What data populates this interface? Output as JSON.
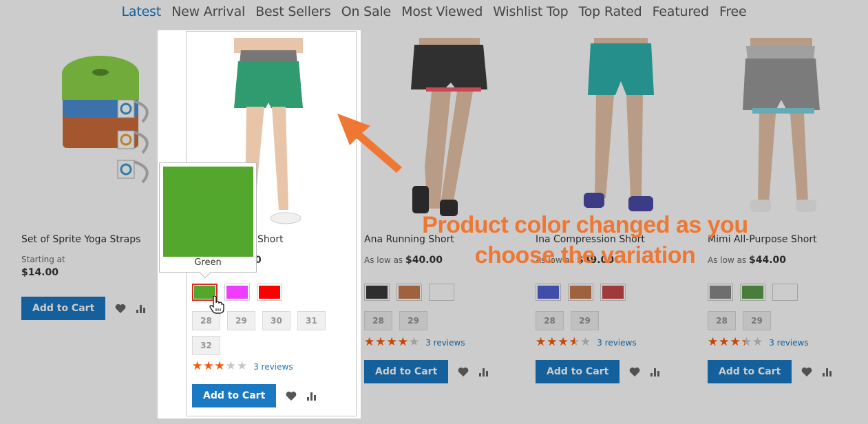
{
  "tabs": [
    {
      "label": "Latest",
      "active": true
    },
    {
      "label": "New Arrival"
    },
    {
      "label": "Best Sellers"
    },
    {
      "label": "On Sale"
    },
    {
      "label": "Most Viewed"
    },
    {
      "label": "Wishlist Top"
    },
    {
      "label": "Top Rated"
    },
    {
      "label": "Featured"
    },
    {
      "label": "Free"
    }
  ],
  "products": [
    {
      "name": "Set of Sprite Yoga Straps",
      "price_label": "Starting at",
      "price": "$14.00",
      "add_to_cart": "Add to Cart"
    },
    {
      "name": "Gwen Drawstring Short",
      "name_visible": "Short",
      "price_visible": "0",
      "swatches": [
        {
          "name": "Green",
          "color": "#53a72c",
          "selected": true
        },
        {
          "name": "Purple",
          "color": "#ef3dff"
        },
        {
          "name": "Red",
          "color": "#ff0000"
        }
      ],
      "sizes": [
        "28",
        "29",
        "30",
        "31",
        "32"
      ],
      "rating": 0.6,
      "reviews": "3 reviews",
      "add_to_cart": "Add to Cart"
    },
    {
      "name": "Ana Running Short",
      "price_label": "As low as",
      "price": "$40.00",
      "swatches": [
        {
          "name": "Black",
          "color": "#3a3a3a"
        },
        {
          "name": "Orange",
          "color": "#c97a4e"
        },
        {
          "name": "White",
          "color": "#ffffff"
        }
      ],
      "sizes": [
        "28",
        "29"
      ],
      "rating": 0.8,
      "reviews": "3 reviews",
      "add_to_cart": "Add to Cart"
    },
    {
      "name": "Ina Compression Short",
      "price_label": "As low as",
      "price": "$49.00",
      "swatches": [
        {
          "name": "Blue",
          "color": "#5162d5"
        },
        {
          "name": "Orange",
          "color": "#c97a4e"
        },
        {
          "name": "Red",
          "color": "#c84848"
        }
      ],
      "sizes": [
        "28",
        "29"
      ],
      "rating": 0.7,
      "reviews": "3 reviews",
      "add_to_cart": "Add to Cart"
    },
    {
      "name": "Mimi All-Purpose Short",
      "price_label": "As low as",
      "price": "$44.00",
      "swatches": [
        {
          "name": "Gray",
          "color": "#8a8a8a"
        },
        {
          "name": "Green",
          "color": "#5b9d4a"
        },
        {
          "name": "White",
          "color": "#ffffff"
        }
      ],
      "sizes": [
        "28",
        "29"
      ],
      "rating": 0.67,
      "reviews": "3 reviews",
      "add_to_cart": "Add to Cart"
    }
  ],
  "tooltip": {
    "label": "Green",
    "color": "#53a72c"
  },
  "annotation": {
    "line1": "Product color changed as you",
    "line2": "choose the variation",
    "color": "#ee7733"
  },
  "colors": {
    "accent": "#1979c3",
    "star": "#ff5501"
  }
}
